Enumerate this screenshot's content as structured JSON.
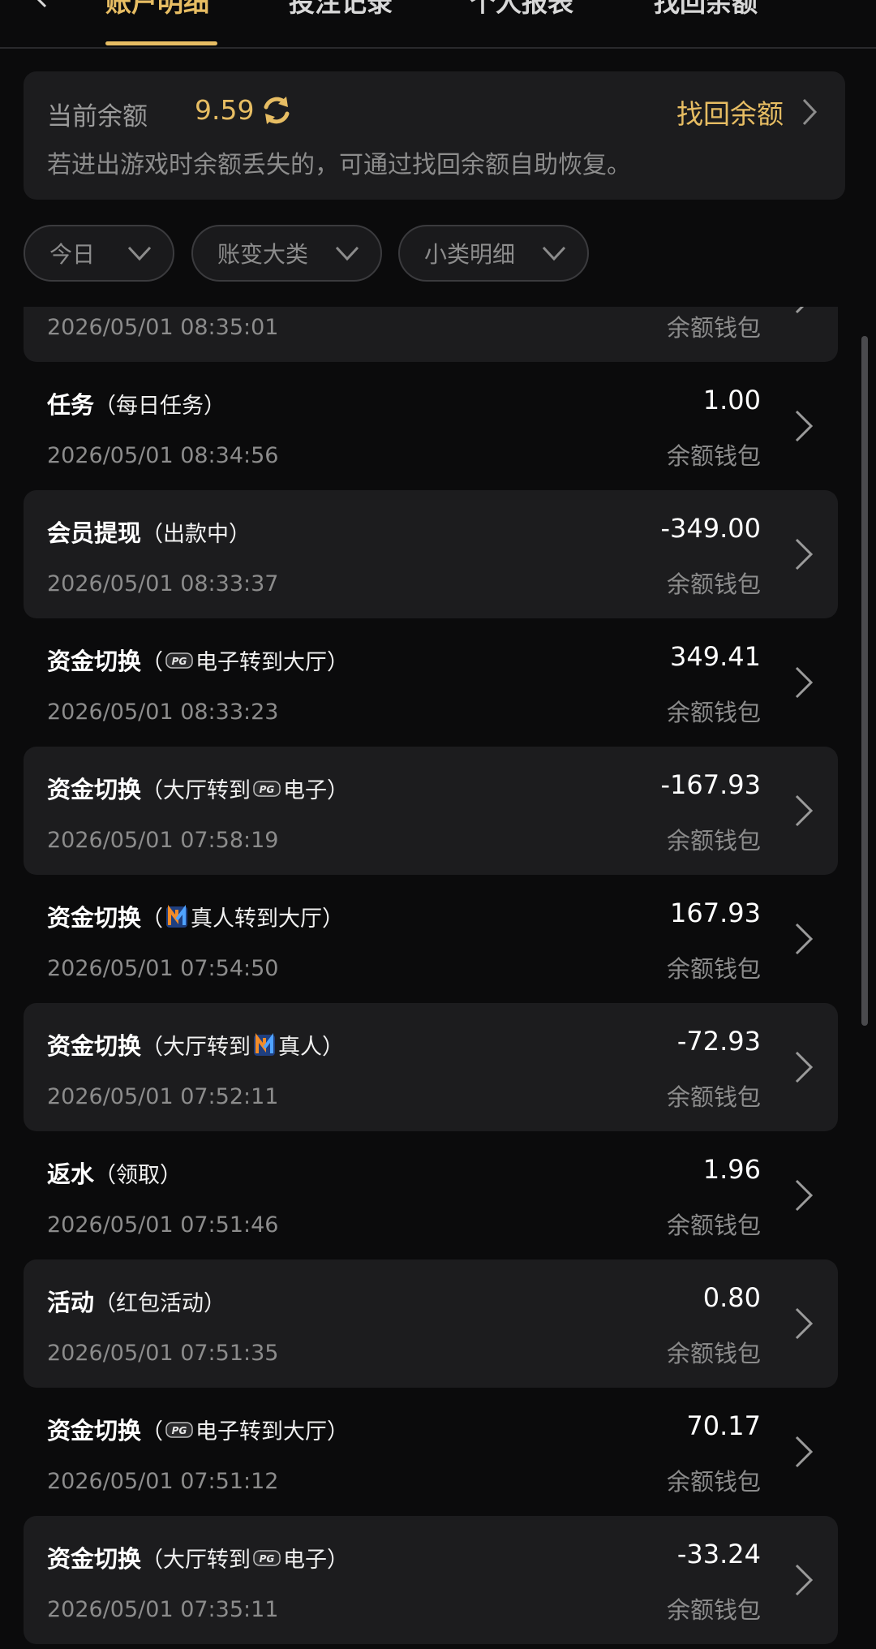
{
  "tabs": [
    {
      "label": "账户明细",
      "active": true
    },
    {
      "label": "投注记录",
      "active": false
    },
    {
      "label": "个人报表",
      "active": false
    },
    {
      "label": "找回余额",
      "active": false
    }
  ],
  "balance": {
    "label": "当前余额",
    "value": "9.59",
    "recover_label": "找回余额",
    "hint": "若进出游戏时余额丢失的，可通过找回余额自助恢复。"
  },
  "filters": [
    {
      "label": "今日"
    },
    {
      "label": "账变大类"
    },
    {
      "label": "小类明细"
    }
  ],
  "rows": [
    {
      "title": "",
      "sub": "",
      "logo": "",
      "amount": "",
      "wallet": "余额钱包",
      "time": "2026/05/01 08:35:01"
    },
    {
      "title": "任务",
      "sub": "（每日任务）",
      "logo": "",
      "amount": "1.00",
      "wallet": "余额钱包",
      "time": "2026/05/01 08:34:56"
    },
    {
      "title": "会员提现",
      "sub": "（出款中）",
      "logo": "",
      "amount": "-349.00",
      "wallet": "余额钱包",
      "time": "2026/05/01 08:33:37"
    },
    {
      "title": "资金切换",
      "sub_pre": "（",
      "logo": "pg",
      "sub_post": "电子转到大厅）",
      "amount": "349.41",
      "wallet": "余额钱包",
      "time": "2026/05/01 08:33:23"
    },
    {
      "title": "资金切换",
      "sub_pre": "（大厅转到",
      "logo": "pg",
      "sub_post": "电子）",
      "amount": "-167.93",
      "wallet": "余额钱包",
      "time": "2026/05/01 07:58:19"
    },
    {
      "title": "资金切换",
      "sub_pre": "（",
      "logo": "live",
      "sub_post": "真人转到大厅）",
      "amount": "167.93",
      "wallet": "余额钱包",
      "time": "2026/05/01 07:54:50"
    },
    {
      "title": "资金切换",
      "sub_pre": "（大厅转到",
      "logo": "live",
      "sub_post": "真人）",
      "amount": "-72.93",
      "wallet": "余额钱包",
      "time": "2026/05/01 07:52:11"
    },
    {
      "title": "返水",
      "sub": "（领取）",
      "logo": "",
      "amount": "1.96",
      "wallet": "余额钱包",
      "time": "2026/05/01 07:51:46"
    },
    {
      "title": "活动",
      "sub": "（红包活动）",
      "logo": "",
      "amount": "0.80",
      "wallet": "余额钱包",
      "time": "2026/05/01 07:51:35"
    },
    {
      "title": "资金切换",
      "sub_pre": "（",
      "logo": "pg",
      "sub_post": "电子转到大厅）",
      "amount": "70.17",
      "wallet": "余额钱包",
      "time": "2026/05/01 07:51:12"
    },
    {
      "title": "资金切换",
      "sub_pre": "（大厅转到",
      "logo": "pg",
      "sub_post": "电子）",
      "amount": "-33.24",
      "wallet": "余额钱包",
      "time": "2026/05/01 07:35:11"
    }
  ],
  "colors": {
    "accent": "#e7bd63",
    "card": "#1c1c1e",
    "background": "#0b0b0c"
  },
  "icons": {
    "refresh": "refresh-icon",
    "chevron": "chevron-right-icon",
    "dropdown": "chevron-down-icon"
  }
}
